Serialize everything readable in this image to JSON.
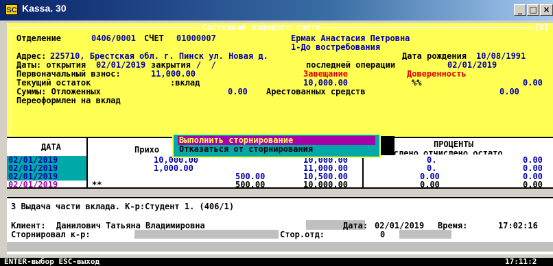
{
  "window": {
    "title": "Kassa. 30",
    "icon_text": "SC",
    "minimize": "_",
    "maximize": "□",
    "close": "×"
  },
  "dialog": {
    "title": "Состояние лицевого счета",
    "close_mark": "[X]",
    "line1_label": "Отделение",
    "department": "0406/0001",
    "account_label": "СЧЕТ",
    "account": "01000007",
    "client": "Ермак Анастасия Петровна",
    "note": "1-До востребования",
    "address_label": "Адрес:",
    "address": "225710, Брестская обл. г. Пинск ул. Новая д.",
    "birth_label": "Дата рождения",
    "birth": "10/08/1991",
    "dates_label": "Даты: открытия",
    "open_date": "02/01/2019",
    "close_label": "закрытия",
    "close_date": "/  /",
    "lastop_label": "последней операции",
    "lastop_date": "02/01/2019",
    "initial_label": "Первоначальный взнос:",
    "initial": "11,000.00",
    "will": "Завещание",
    "proxy": "Доверенность",
    "balance_label": "Текущий остаток",
    "balance_type": ":вклад",
    "balance": "10,000.00",
    "pct": "%%",
    "pct_val": "0.00",
    "deferred_label": "Суммы: Отложенных",
    "deferred": "0.00",
    "arrest_label": "Арестованных средств",
    "arrest": "0.00",
    "reissued": "Переоформлен на вклад"
  },
  "table": {
    "col_date": "ДАТА",
    "col_income": "Прихо",
    "col_interest": "ПРОЦЕНТЫ",
    "col_interest_sub": "ачислено отчислено остато",
    "rows": [
      {
        "date": "02/01/2019",
        "mark": "",
        "income": "10,000.00",
        "expense": "",
        "rest": "10,000.00",
        "p1": "0.",
        "p3": "0.00"
      },
      {
        "date": "02/01/2019",
        "mark": "",
        "income": "1,000.00",
        "expense": "",
        "rest": "11,000.00",
        "p1": "0.",
        "p3": "0.00"
      },
      {
        "date": "02/01/2019",
        "mark": "",
        "income": "",
        "expense": "500.00",
        "rest": "10,500.00",
        "p1": "0.00",
        "p3": "0.00"
      },
      {
        "date": "02/01/2019",
        "mark": "**",
        "income": "",
        "expense": "500.00",
        "rest": "10,000.00",
        "p1": "0.00",
        "p3": "0.00"
      }
    ]
  },
  "popup": {
    "option1": "Выполнить сторнирование",
    "option2": "Отказаться от сторнирования"
  },
  "info": {
    "operation": "3 Выдача части вклада. К-р:Студент 1. (406/1)",
    "client_label": "Клиент:",
    "client": "Данилович Татьяна Владимировна",
    "date_label": "Дата:",
    "date": "02/01/2019",
    "time_label": "Время:",
    "time": "17:02:16",
    "storno_label": "Сторнировал к-р:",
    "dept_label": "Стор.отд:",
    "dept": "0"
  },
  "status": {
    "left": "ENTER-выбор ESC-выход",
    "clock": "17:11:2"
  }
}
